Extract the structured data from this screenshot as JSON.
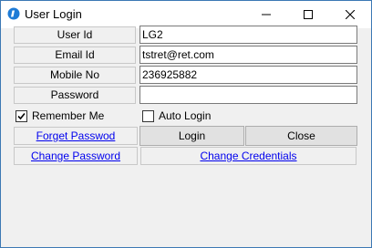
{
  "window": {
    "title": "User Login"
  },
  "form": {
    "user_id_label": "User Id",
    "user_id_value": "LG2",
    "email_label": "Email Id",
    "email_value": "tstret@ret.com",
    "mobile_label": "Mobile No",
    "mobile_value": "236925882",
    "password_label": "Password",
    "password_value": ""
  },
  "options": {
    "remember_me_label": "Remember Me",
    "remember_me_checked": true,
    "auto_login_label": "Auto Login",
    "auto_login_checked": false
  },
  "actions": {
    "forget_password": "Forget Passwod",
    "login": "Login",
    "close": "Close",
    "change_password": "Change Password",
    "change_credentials": "Change Credentials"
  },
  "colors": {
    "accent": "#3c78b4",
    "link": "#0000ee"
  }
}
